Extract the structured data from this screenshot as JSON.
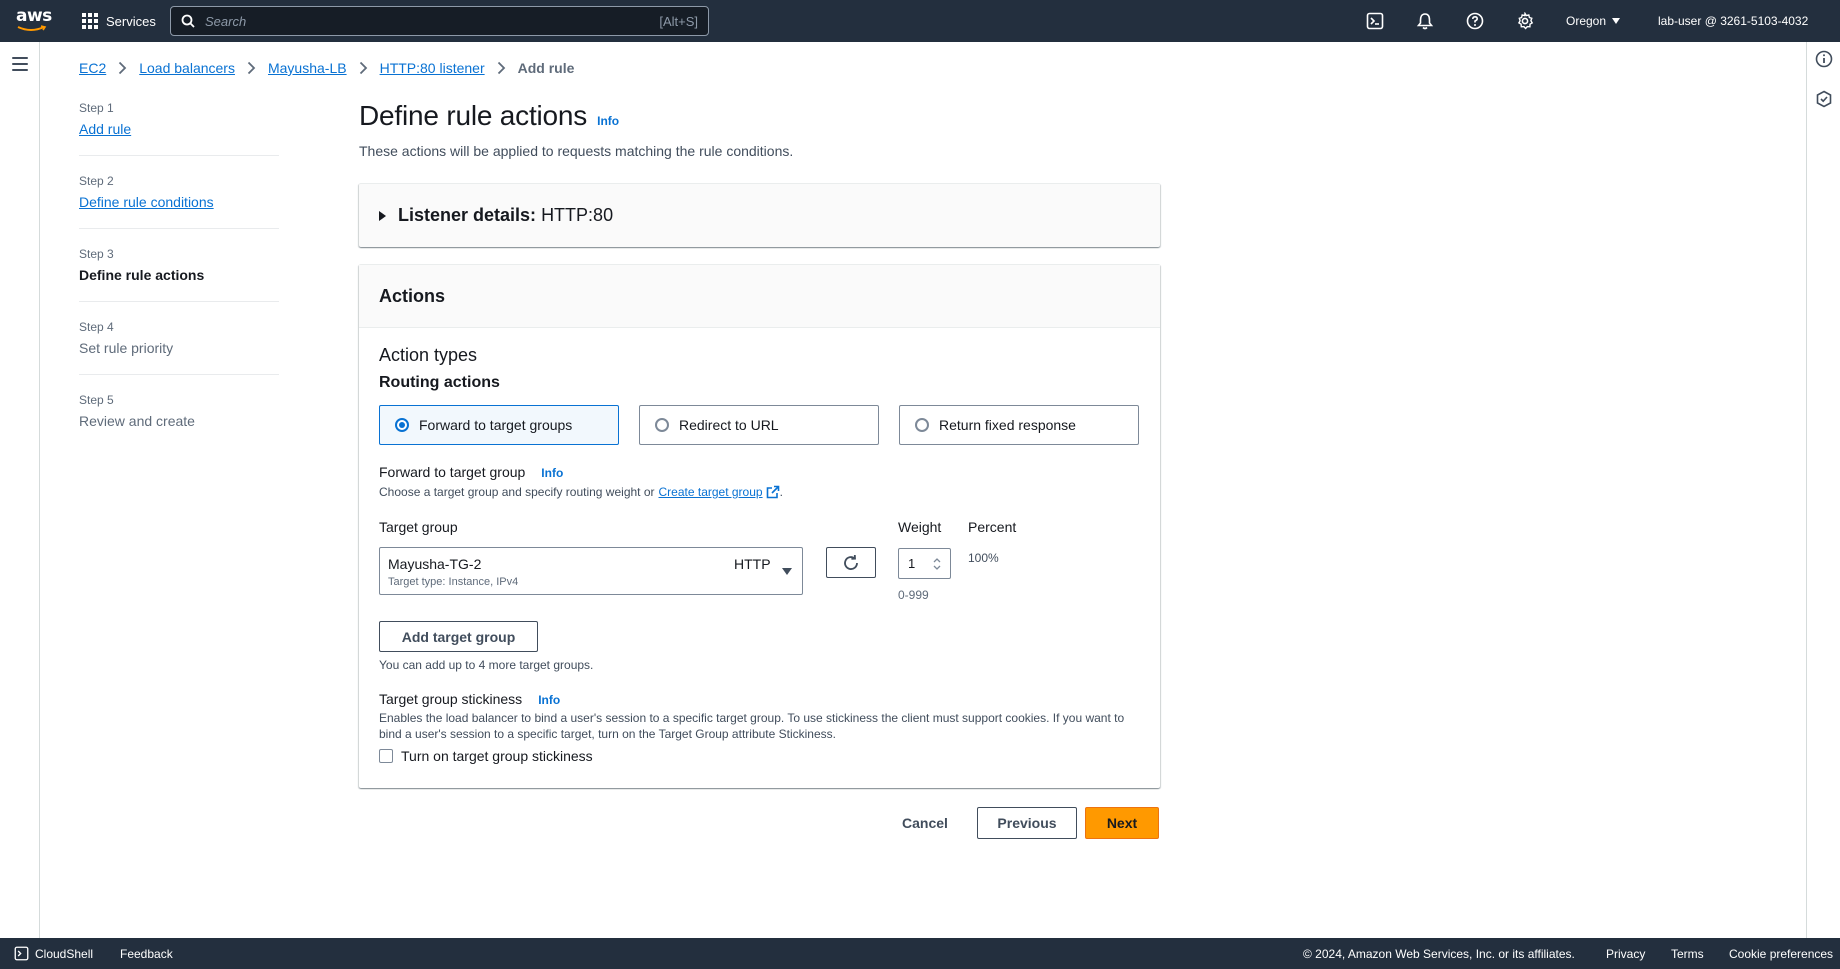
{
  "topnav": {
    "logo_text": "aws",
    "services_label": "Services",
    "search_placeholder": "Search",
    "search_shortcut": "[Alt+S]",
    "region": "Oregon",
    "account": "lab-user @ 3261-5103-4032"
  },
  "breadcrumb": {
    "items": [
      "EC2",
      "Load balancers",
      "Mayusha-LB",
      "HTTP:80 listener"
    ],
    "current": "Add rule"
  },
  "steps": [
    {
      "num": "Step 1",
      "title": "Add rule"
    },
    {
      "num": "Step 2",
      "title": "Define rule conditions"
    },
    {
      "num": "Step 3",
      "title": "Define rule actions"
    },
    {
      "num": "Step 4",
      "title": "Set rule priority"
    },
    {
      "num": "Step 5",
      "title": "Review and create"
    }
  ],
  "main": {
    "title": "Define rule actions",
    "info": "Info",
    "description": "These actions will be applied to requests matching the rule conditions.",
    "listener_label": "Listener details:",
    "listener_value": "HTTP:80",
    "actions_header": "Actions",
    "action_types": "Action types",
    "routing_actions": "Routing actions",
    "routing_options": [
      "Forward to target groups",
      "Redirect to URL",
      "Return fixed response"
    ],
    "forward_label": "Forward to target group",
    "forward_desc": "Choose a target group and specify routing weight or",
    "create_tg_link": "Create target group",
    "target_group_label": "Target group",
    "target_group_name": "Mayusha-TG-2",
    "target_group_protocol": "HTTP",
    "target_group_type": "Target type: Instance, IPv4",
    "weight_label": "Weight",
    "weight_value": "1",
    "weight_hint": "0-999",
    "percent_label": "Percent",
    "percent_value": "100%",
    "add_tg_button": "Add target group",
    "add_tg_hint": "You can add up to 4 more target groups.",
    "stickiness_label": "Target group stickiness",
    "stickiness_desc": "Enables the load balancer to bind a user's session to a specific target group. To use stickiness the client must support cookies. If you want to bind a user's session to a specific target, turn on the Target Group attribute Stickiness.",
    "stickiness_checkbox": "Turn on target group stickiness"
  },
  "footer_buttons": {
    "cancel": "Cancel",
    "previous": "Previous",
    "next": "Next"
  },
  "bottombar": {
    "cloudshell": "CloudShell",
    "feedback": "Feedback",
    "copyright": "© 2024, Amazon Web Services, Inc. or its affiliates.",
    "privacy": "Privacy",
    "terms": "Terms",
    "cookie": "Cookie preferences"
  },
  "colors": {
    "nav_bg": "#232f3e",
    "link": "#0972d3",
    "primary_button": "#ff9900"
  }
}
